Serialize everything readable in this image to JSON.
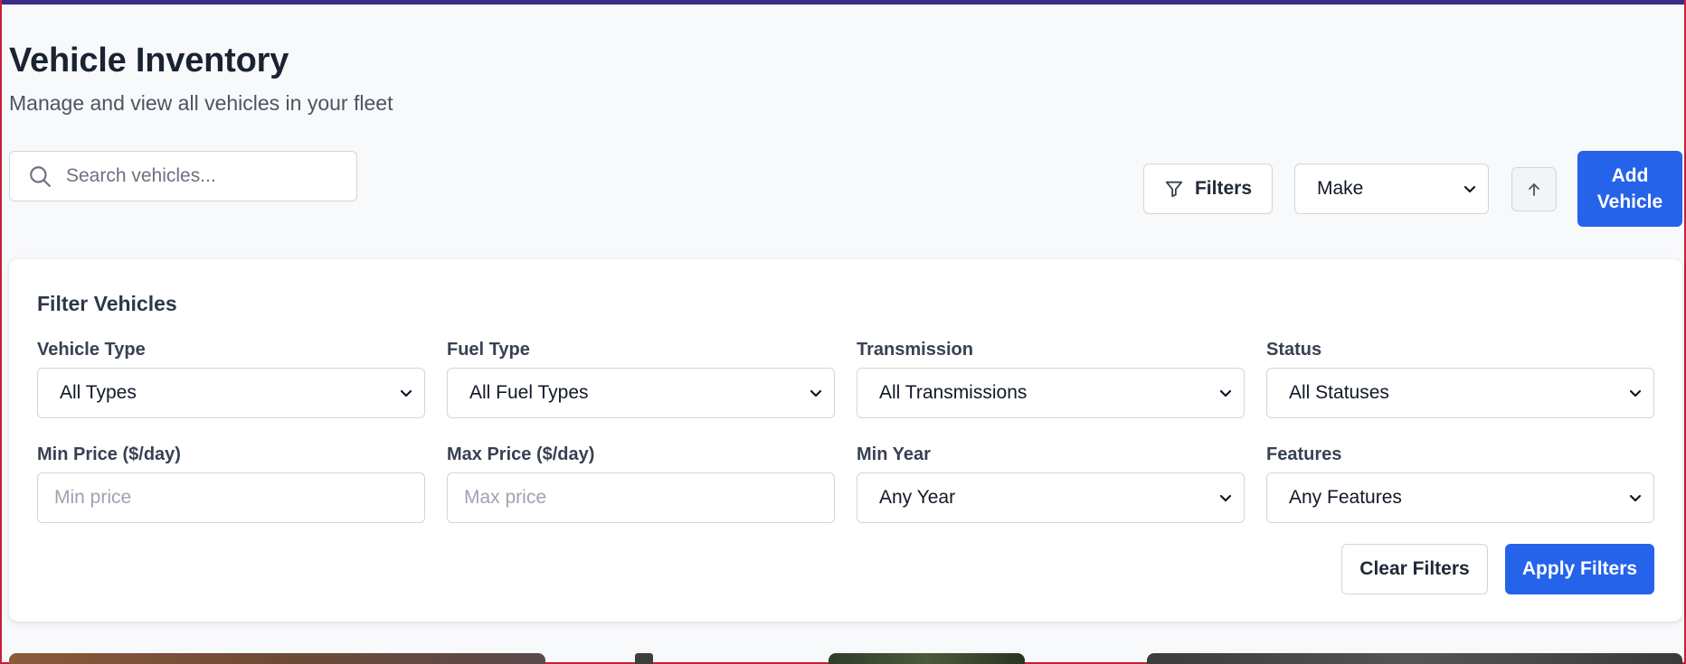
{
  "header": {
    "title": "Vehicle Inventory",
    "subtitle": "Manage and view all vehicles in your fleet"
  },
  "toolbar": {
    "search_placeholder": "Search vehicles...",
    "filters_label": "Filters",
    "sort_by_selected": "Make",
    "sort_direction_icon": "arrow-up-icon",
    "add_vehicle_label": "Add Vehicle"
  },
  "filter_panel": {
    "title": "Filter Vehicles",
    "vehicle_type": {
      "label": "Vehicle Type",
      "selected": "All Types"
    },
    "fuel_type": {
      "label": "Fuel Type",
      "selected": "All Fuel Types"
    },
    "transmission": {
      "label": "Transmission",
      "selected": "All Transmissions"
    },
    "status": {
      "label": "Status",
      "selected": "All Statuses"
    },
    "min_price": {
      "label": "Min Price ($/day)",
      "placeholder": "Min price"
    },
    "max_price": {
      "label": "Max Price ($/day)",
      "placeholder": "Max price"
    },
    "min_year": {
      "label": "Min Year",
      "selected": "Any Year"
    },
    "features": {
      "label": "Features",
      "selected": "Any Features"
    },
    "clear_label": "Clear Filters",
    "apply_label": "Apply Filters"
  },
  "colors": {
    "primary": "#2563eb",
    "page_background": "#f8f9fb",
    "border": "#d1d5db",
    "title_text": "#1a2332"
  }
}
